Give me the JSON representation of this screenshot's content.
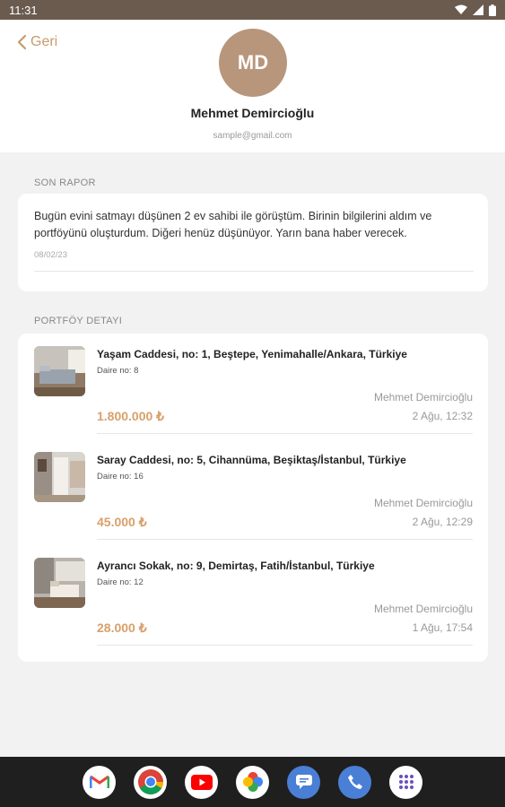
{
  "status_bar": {
    "time": "11:31"
  },
  "header": {
    "back_label": "Geri",
    "avatar_initials": "MD",
    "name": "Mehmet Demircioğlu",
    "email": "sample@gmail.com"
  },
  "report": {
    "section_title": "SON RAPOR",
    "text": "Bugün evini satmayı düşünen 2 ev sahibi ile görüştüm. Birinin bilgilerini aldım ve portföyünü oluşturdum. Diğeri henüz düşünüyor. Yarın bana haber verecek.",
    "date": "08/02/23"
  },
  "portfolio": {
    "section_title": "PORTFÖY DETAYI",
    "items": [
      {
        "address": "Yaşam Caddesi, no: 1, Beştepe, Yenimahalle/Ankara, Türkiye",
        "daire": "Daire no: 8",
        "agent": "Mehmet Demircioğlu",
        "price": "1.800.000 ₺",
        "date": "2 Ağu, 12:32"
      },
      {
        "address": "Saray Caddesi, no: 5, Cihannüma, Beşiktaş/İstanbul, Türkiye",
        "daire": "Daire no: 16",
        "agent": "Mehmet Demircioğlu",
        "price": "45.000 ₺",
        "date": "2 Ağu, 12:29"
      },
      {
        "address": "Ayrancı Sokak, no: 9, Demirtaş, Fatih/İstanbul, Türkiye",
        "daire": "Daire no: 12",
        "agent": "Mehmet Demircioğlu",
        "price": "28.000 ₺",
        "date": "1 Ağu, 17:54"
      }
    ]
  },
  "nav": {
    "icons": [
      "gmail-icon",
      "chrome-icon",
      "youtube-icon",
      "photos-icon",
      "messages-icon",
      "phone-icon",
      "apps-icon"
    ]
  },
  "colors": {
    "accent": "#d8a06a",
    "avatar": "#b8967b",
    "status_bar": "#6b5b4f"
  }
}
